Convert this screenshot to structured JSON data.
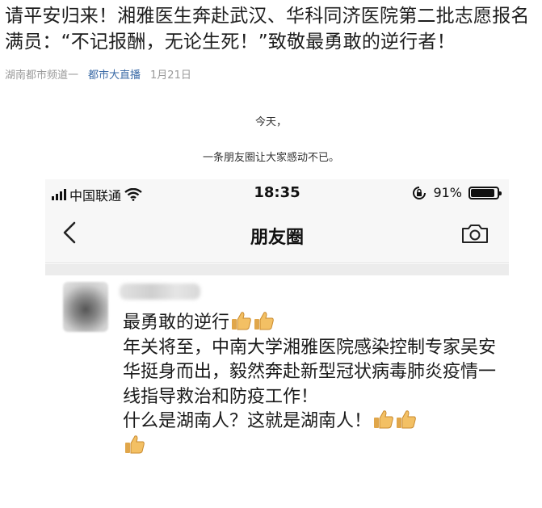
{
  "article": {
    "headline": "请平安归来！湘雅医生奔赴武汉、华科同济医院第二批志愿报名满员：“不记报酬，无论生死！”致敬最勇敢的逆行者！",
    "source": "湖南都市频道一",
    "tag": "都市大直播",
    "date": "1月21日",
    "caption_1": "今天，",
    "caption_2": "一条朋友圈让大家感动不已。"
  },
  "phone": {
    "carrier": "中国联通",
    "time": "18:35",
    "battery": "91%",
    "battery_level": 0.91,
    "nav_title": "朋友圈",
    "icons": {
      "back": "chevron-left-icon",
      "camera": "camera-icon",
      "wifi": "wifi-icon",
      "lock": "rotation-lock-icon",
      "battery": "battery-icon",
      "thumbs": "thumbs-up-icon"
    },
    "post": {
      "line_1": "最勇敢的逆行",
      "line_2": "年关将至，中南大学湘雅医院感染控制专家吴安华挺身而出，毅然奔赴新型冠状病毒肺炎疫情一线指导救治和防疫工作！",
      "line_3": "什么是湖南人？这就是湖南人！"
    }
  }
}
